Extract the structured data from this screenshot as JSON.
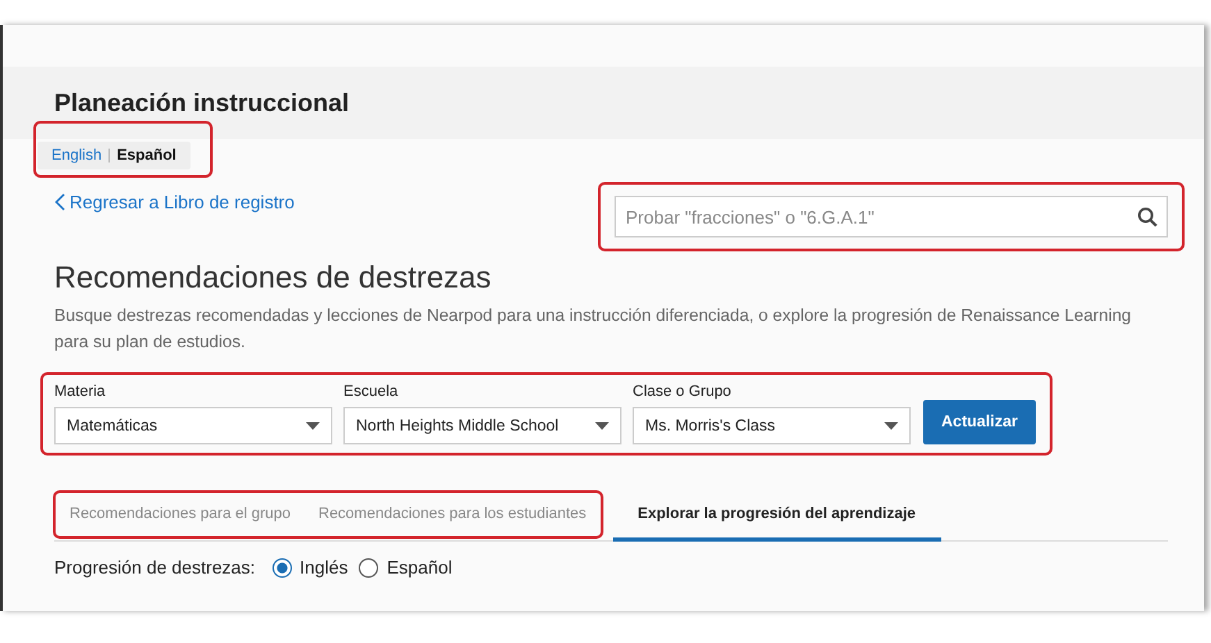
{
  "header": {
    "title": "Planeación instruccional"
  },
  "language_toggle": {
    "highlighted": true,
    "options": [
      {
        "label": "English",
        "selected": false
      },
      {
        "label": "Español",
        "selected": true
      }
    ]
  },
  "back_link": {
    "label": "Regresar a Libro de registro"
  },
  "search": {
    "placeholder": "Probar \"fracciones\" o \"6.G.A.1\"",
    "highlighted": true
  },
  "section": {
    "title": "Recomendaciones de destrezas",
    "description": "Busque destrezas recomendadas y lecciones de Nearpod para una instrucción diferenciada, o explore la progresión de Renaissance Learning para su plan de estudios."
  },
  "filters": {
    "highlighted": true,
    "fields": [
      {
        "label": "Materia",
        "value": "Matemáticas"
      },
      {
        "label": "Escuela",
        "value": "North Heights Middle School"
      },
      {
        "label": "Clase o Grupo",
        "value": "Ms. Morris's Class"
      }
    ],
    "button": "Actualizar"
  },
  "tabs": [
    {
      "label": "Recomendaciones para el grupo",
      "selected": false,
      "highlighted": true
    },
    {
      "label": "Recomendaciones para los estudiantes",
      "selected": false,
      "highlighted": true
    },
    {
      "label": "Explorar la progresión del aprendizaje",
      "selected": true,
      "highlighted": false
    }
  ],
  "skill_progression": {
    "label": "Progresión de destrezas:",
    "options": [
      {
        "label": "Inglés",
        "selected": true
      },
      {
        "label": "Español",
        "selected": false
      }
    ]
  }
}
